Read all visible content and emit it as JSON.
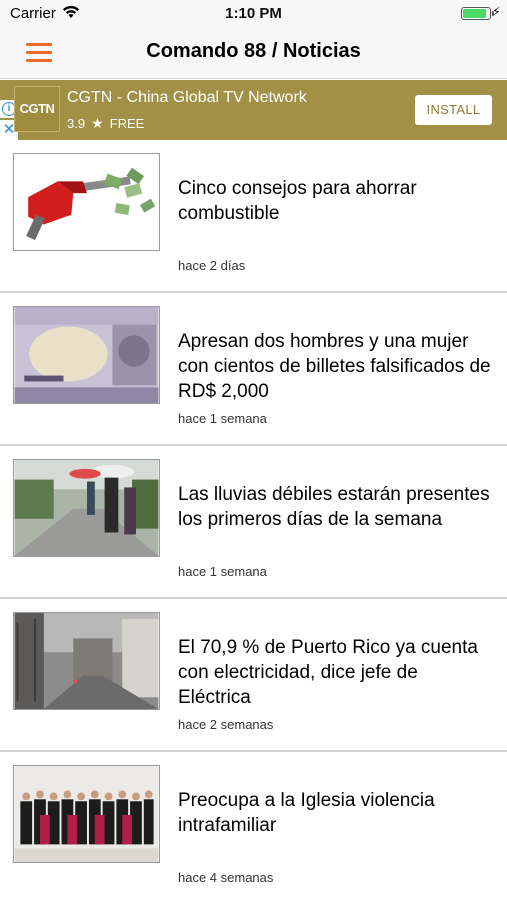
{
  "status_bar": {
    "carrier": "Carrier",
    "time": "1:10 PM",
    "battery_level": 0.8
  },
  "nav": {
    "title": "Comando 88 / Noticias",
    "menu_icon": "hamburger-menu-icon",
    "accent_color": "#ef6a2b"
  },
  "ad": {
    "logo_text": "CGTN",
    "title": "CGTN - China Global TV Network",
    "rating": "3.9",
    "price": "FREE",
    "install_label": "INSTALL",
    "background_color": "#a29047"
  },
  "news": [
    {
      "headline": "Cinco consejos para ahorrar combustible",
      "time": "hace 2 días",
      "image": "fuel-nozzle-money"
    },
    {
      "headline": "Apresan dos hombres y una mujer con cientos de billetes falsificados de RD$ 2,000",
      "time": "hace 1 semana",
      "image": "banknote"
    },
    {
      "headline": "Las lluvias débiles estarán presentes los primeros días de la semana",
      "time": "hace 1 semana",
      "image": "rain-umbrellas-street"
    },
    {
      "headline": "El 70,9 % de Puerto Rico ya cuenta con electricidad, dice jefe de Eléctrica",
      "time": "hace 2 semanas",
      "image": "rainy-city-street"
    },
    {
      "headline": "Preocupa a la Iglesia violencia intrafamiliar",
      "time": "hace 4 semanas",
      "image": "bishops-group-photo"
    }
  ]
}
